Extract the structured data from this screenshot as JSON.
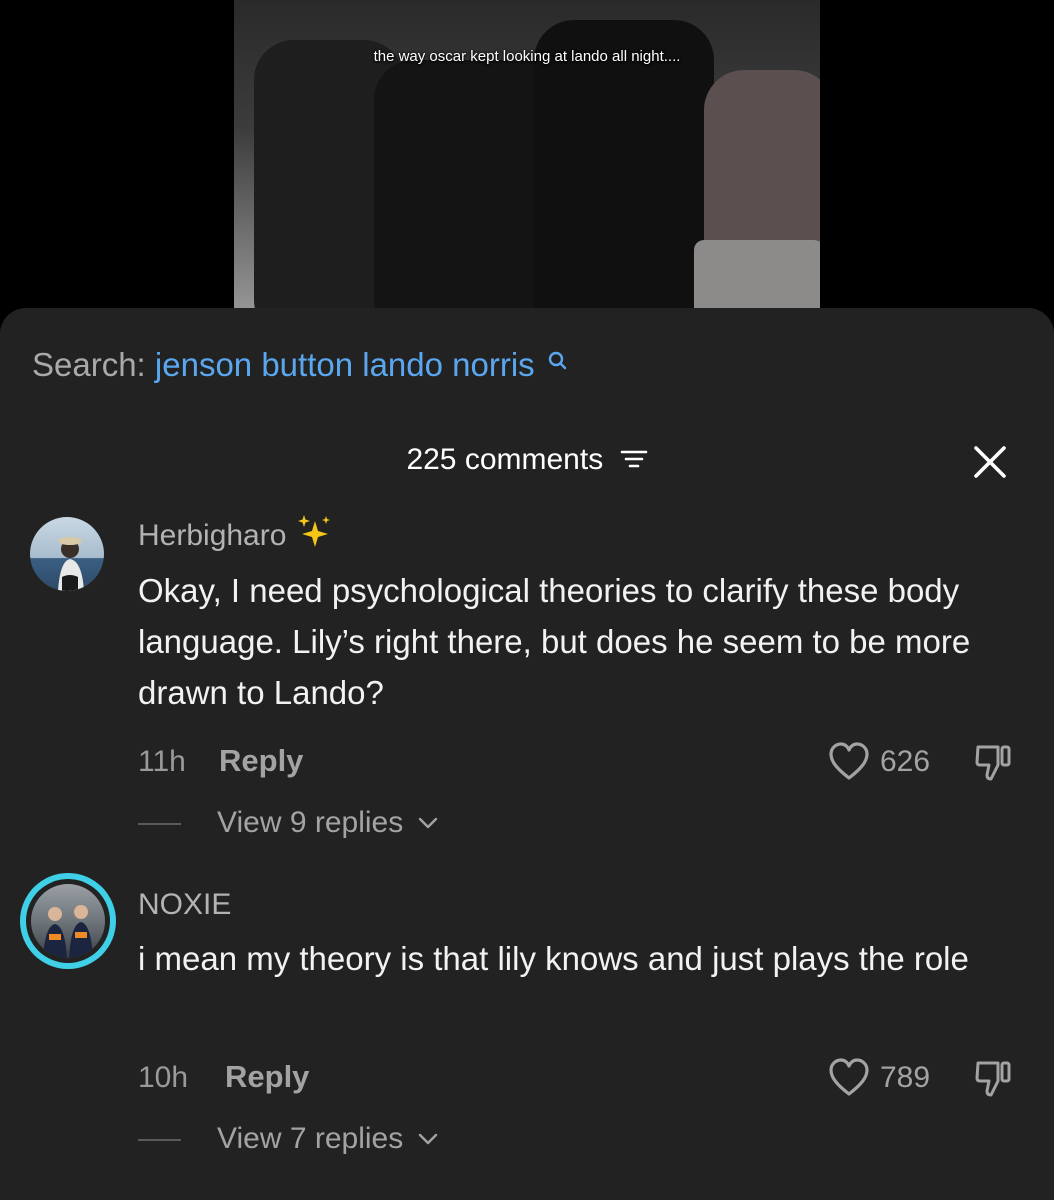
{
  "video": {
    "caption": "the way oscar kept looking at lando all night...."
  },
  "search": {
    "label": "Search:",
    "query": "jenson button lando norris"
  },
  "header": {
    "count_label": "225 comments"
  },
  "comments": [
    {
      "username": "Herbigharo",
      "text": "Okay, I need psychological theories to clarify these body language. Lily’s right there, but does he seem to be more drawn to Lando?",
      "time": "11h",
      "reply_label": "Reply",
      "likes": "626",
      "view_replies": "View 9 replies"
    },
    {
      "username": "NOXIE",
      "text": "i mean my theory is that lily knows and just plays the role",
      "time": "10h",
      "reply_label": "Reply",
      "likes": "789",
      "view_replies": "View 7 replies"
    }
  ],
  "icons": {
    "search": "search-icon",
    "filter": "filter-icon",
    "close": "close-icon",
    "sparkle": "sparkles-icon",
    "heart": "heart-icon",
    "dislike": "thumbs-down-icon",
    "chevron": "chevron-down-icon"
  },
  "colors": {
    "sheet_background": "#222222",
    "search_query": "#5aa7f0",
    "avatar_ring": "#3fd0e8"
  }
}
